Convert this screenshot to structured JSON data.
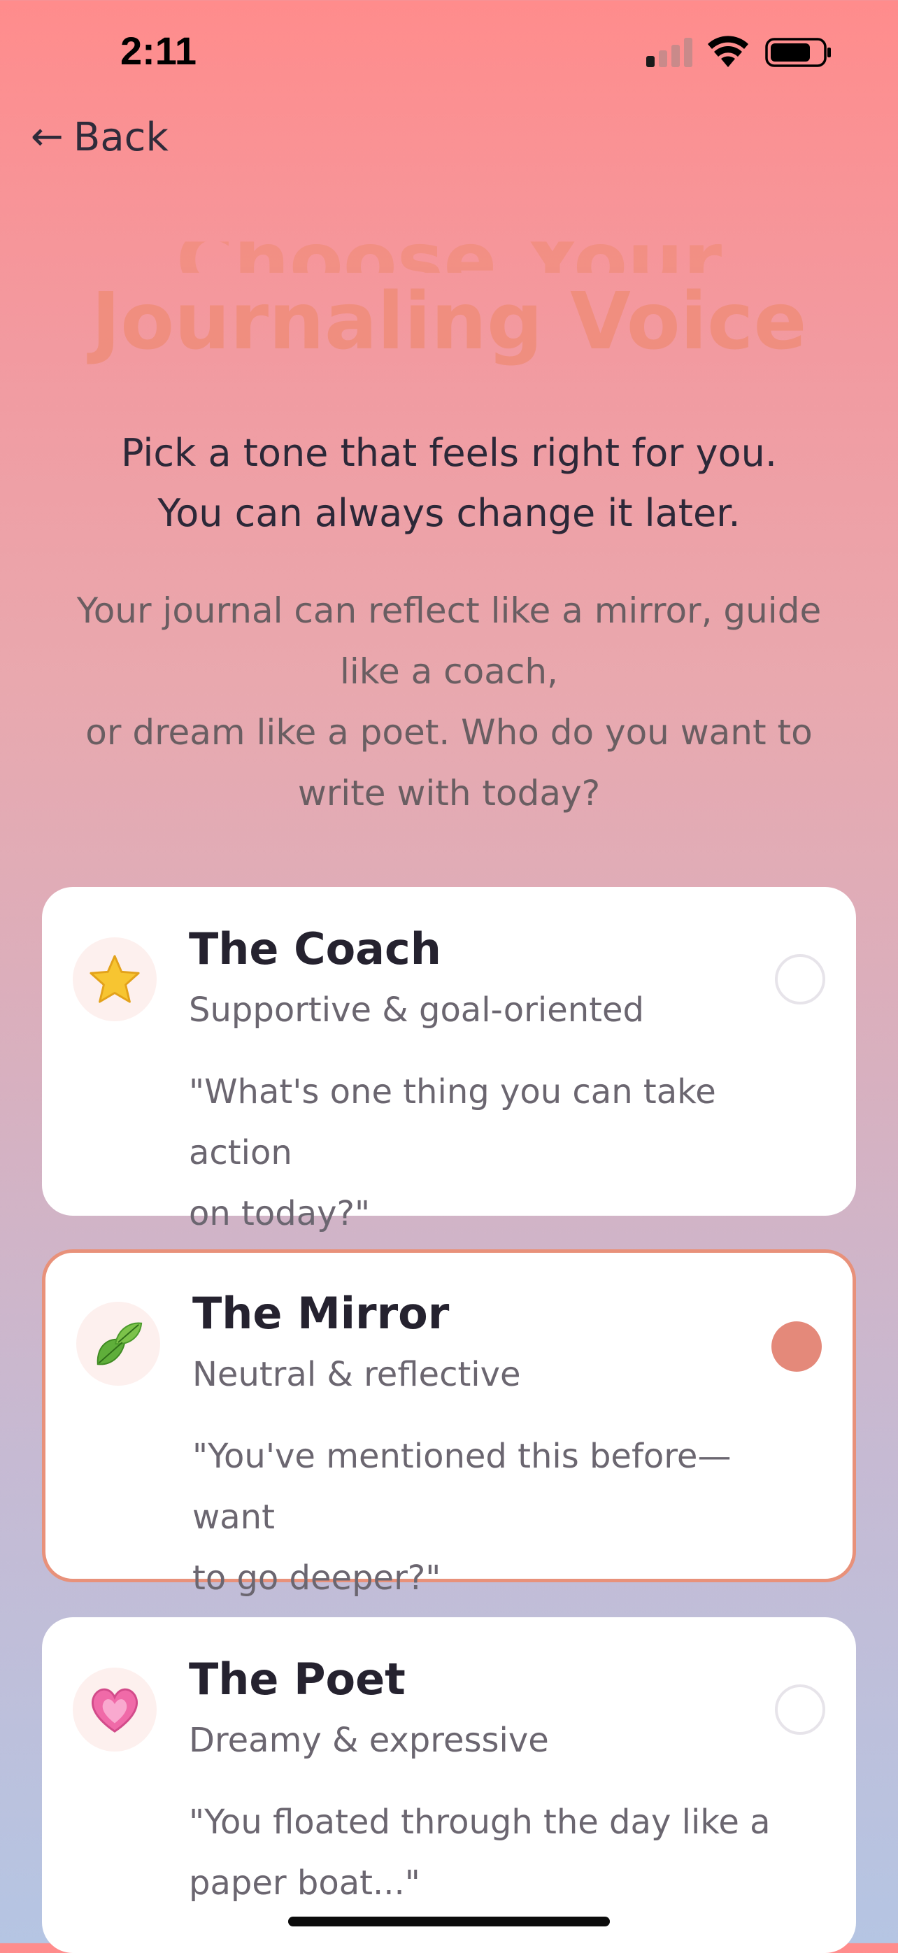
{
  "status_bar": {
    "time": "2:11"
  },
  "nav": {
    "back_label": "Back"
  },
  "header": {
    "title_ghost": "Choose Your",
    "title": "Journaling Voice",
    "subtitle_line1": "Pick a tone that feels right for you.",
    "subtitle_line2": "You can always change it later.",
    "description_line1": "Your journal can reflect like a mirror, guide",
    "description_line2": "like a coach,",
    "description_line3": "or dream like a poet. Who do you want to",
    "description_line4": "write with today?"
  },
  "voices": [
    {
      "name": "The Coach",
      "tagline": "Supportive & goal-oriented",
      "quote_line1": "\"What's one thing you can take action",
      "quote_line2": "on today?\"",
      "icon": "star-icon",
      "selected": false
    },
    {
      "name": "The Mirror",
      "tagline": "Neutral & reflective",
      "quote_line1": "\"You've mentioned this before—want",
      "quote_line2": "to go deeper?\"",
      "icon": "leaves-icon",
      "selected": true
    },
    {
      "name": "The Poet",
      "tagline": "Dreamy & expressive",
      "quote_line1": "\"You floated through the day like a",
      "quote_line2": "paper boat...\"",
      "icon": "heart-icon",
      "selected": false
    }
  ],
  "colors": {
    "accent": "#e4897a",
    "title": "#ef8a72"
  }
}
